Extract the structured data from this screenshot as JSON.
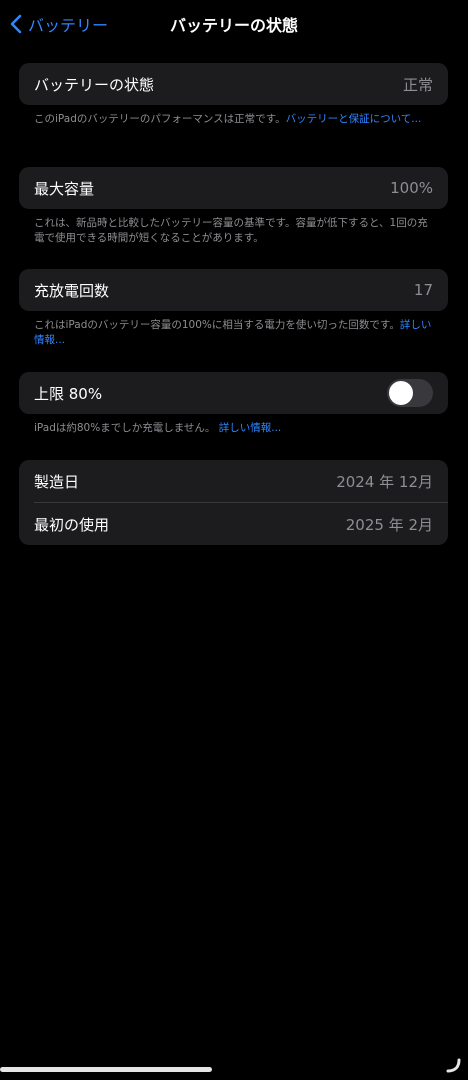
{
  "nav": {
    "back_label": "バッテリー",
    "title": "バッテリーの状態"
  },
  "battery_health": {
    "label": "バッテリーの状態",
    "value": "正常",
    "footnote_text": "このiPadのバッテリーのパフォーマンスは正常です。",
    "footnote_link": "バッテリーと保証について..."
  },
  "max_capacity": {
    "label": "最大容量",
    "value": "100%",
    "footnote_text": "これは、新品時と比較したバッテリー容量の基準です。容量が低下すると、1回の充電で使用できる時間が短くなることがあります。"
  },
  "cycle_count": {
    "label": "充放電回数",
    "value": "17",
    "footnote_text": "これはiPadのバッテリー容量の100%に相当する電力を使い切った回数です。",
    "footnote_link": "詳しい情報..."
  },
  "limit": {
    "label": "上限 80%",
    "enabled": false,
    "footnote_text": "iPadは約80%までしか充電しません。",
    "footnote_link": "詳しい情報..."
  },
  "manufacture": {
    "label": "製造日",
    "value": "2024 年 12月"
  },
  "first_use": {
    "label": "最初の使用",
    "value": "2025 年 2月"
  },
  "colors": {
    "accent": "#2f86ff",
    "background": "#000000",
    "card": "#1c1c1e"
  }
}
